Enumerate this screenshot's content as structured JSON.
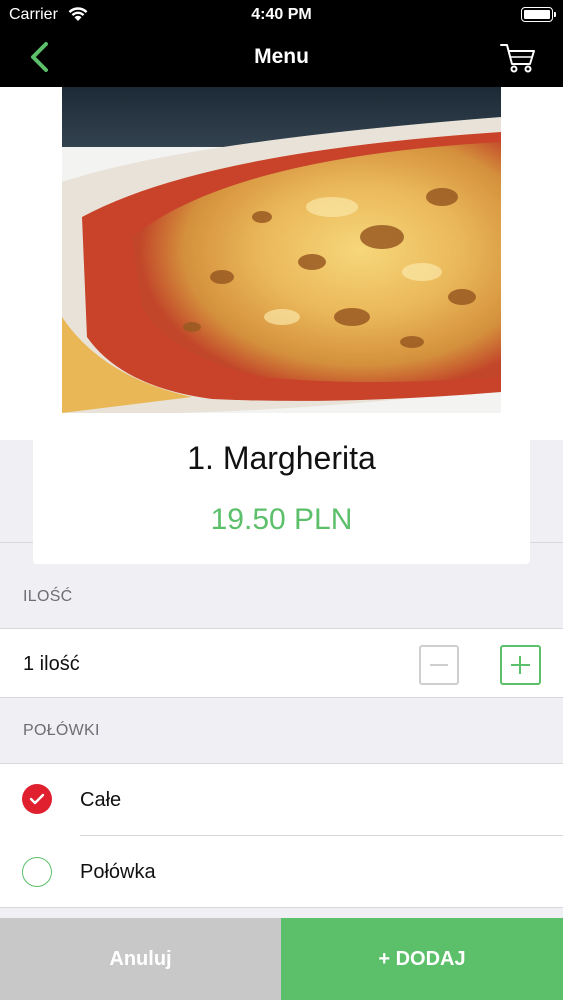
{
  "status_bar": {
    "carrier": "Carrier",
    "time": "4:40 PM"
  },
  "nav": {
    "title": "Menu",
    "back_icon": "chevron-left-icon",
    "cart_icon": "cart-icon"
  },
  "product": {
    "name": "1. Margherita",
    "price": "19.50 PLN",
    "image": "margherita-pizza-photo"
  },
  "quantity_section": {
    "header": "ILOŚĆ",
    "value_label": "1 ilość",
    "minus_icon": "minus-icon",
    "plus_icon": "plus-icon"
  },
  "halves_section": {
    "header": "POŁÓWKI",
    "options": [
      {
        "label": "Całe",
        "selected": true
      },
      {
        "label": "Połówka",
        "selected": false
      }
    ]
  },
  "actions": {
    "cancel_label": "Anuluj",
    "add_label": "+ DODAJ"
  },
  "colors": {
    "accent_green": "#5cbf6a",
    "selected_red": "#e0202f",
    "cancel_gray": "#c8c8c8",
    "nav_black": "#000000"
  }
}
